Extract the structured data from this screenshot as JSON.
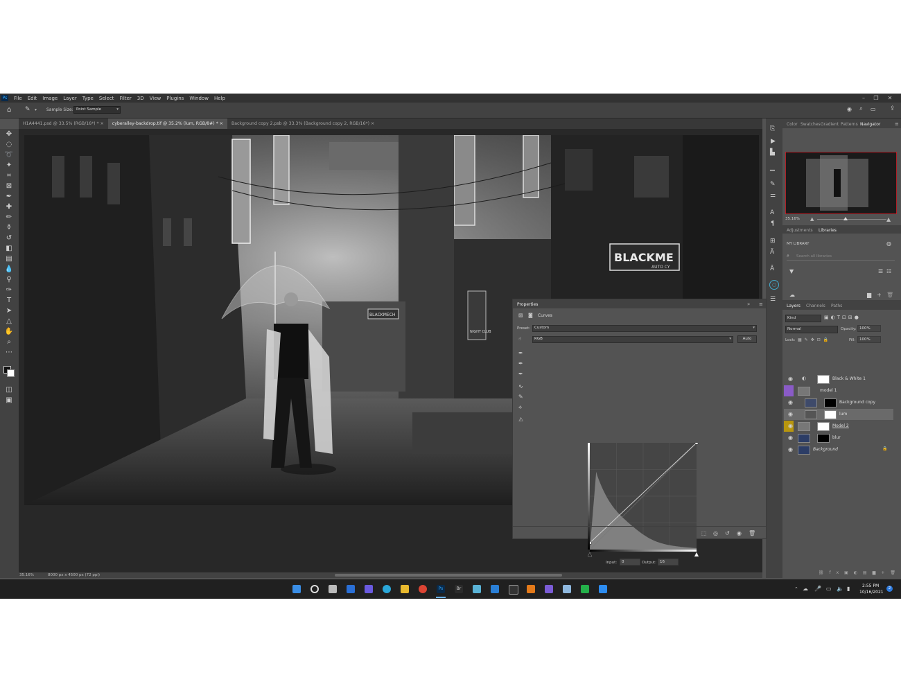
{
  "menu": [
    "File",
    "Edit",
    "Image",
    "Layer",
    "Type",
    "Select",
    "Filter",
    "3D",
    "View",
    "Plugins",
    "Window",
    "Help"
  ],
  "options_bar": {
    "sample_size_label": "Sample Size:",
    "sample_size_value": "Point Sample"
  },
  "doc_tabs": [
    {
      "label": "H1A4441.psd @ 33.5% (RGB/16*) *",
      "active": false
    },
    {
      "label": "cyberalley-backdrop.tif @ 35.2% (lum, RGB/8#) *",
      "active": true
    },
    {
      "label": "Background copy 2.psb @ 33.3% (Background copy 2, RGB/16*)",
      "active": false
    }
  ],
  "status": {
    "zoom": "35.16%",
    "doc_info": "8000 px x 4500 px (72 ppi)"
  },
  "canvas_signs": {
    "sign_a": "BLACKME",
    "sign_a_sub": "AUTO CY",
    "sign_b": "BLACKMECH",
    "sign_c": "NIGHT CLUB"
  },
  "properties": {
    "title": "Properties",
    "type_label": "Curves",
    "preset_label": "Preset:",
    "preset_value": "Custom",
    "channel_value": "RGB",
    "auto_label": "Auto",
    "input_label": "Input:",
    "input_value": "0",
    "output_label": "Output:",
    "output_value": "16"
  },
  "right_panel": {
    "top_tabs": [
      "Color",
      "Swatches",
      "Gradient",
      "Patterns",
      "Navigator"
    ],
    "active_top_tab": "Navigator",
    "nav_zoom": "35.16%",
    "lib_tabs": [
      "Adjustments",
      "Libraries"
    ],
    "active_lib_tab": "Libraries",
    "my_library": "MY LIBRARY",
    "search_placeholder": "Search all libraries",
    "layers_tabs": [
      "Layers",
      "Channels",
      "Paths"
    ],
    "kind_label": "Kind",
    "blend_mode": "Normal",
    "opacity_label": "Opacity:",
    "opacity_value": "100%",
    "lock_label": "Lock:",
    "fill_label": "Fill:",
    "fill_value": "100%",
    "layers": [
      {
        "name": "Black & White 1",
        "visible": true,
        "selected": false
      },
      {
        "name": "model 1",
        "visible": false,
        "selected": false
      },
      {
        "name": "Background copy",
        "visible": true,
        "selected": false
      },
      {
        "name": "lum",
        "visible": true,
        "selected": true
      },
      {
        "name": "Model 2",
        "visible": true,
        "selected": false
      },
      {
        "name": "blur",
        "visible": true,
        "selected": false
      },
      {
        "name": "Background",
        "visible": true,
        "selected": false
      }
    ]
  },
  "taskbar": {
    "time": "2:55 PM",
    "date": "10/16/2021",
    "notification_count": "2"
  },
  "colors": {
    "app_bg": "#535353",
    "panel_dark": "#424242",
    "accent_blue": "#1473e6",
    "nav_red": "#e0202a",
    "taskbar": "#202020"
  },
  "chart_data": {
    "type": "line",
    "title": "Curves",
    "xlabel": "Input",
    "ylabel": "Output",
    "xlim": [
      0,
      255
    ],
    "ylim": [
      0,
      255
    ],
    "series": [
      {
        "values": [
          [
            0,
            16
          ],
          [
            255,
            255
          ]
        ]
      }
    ]
  }
}
